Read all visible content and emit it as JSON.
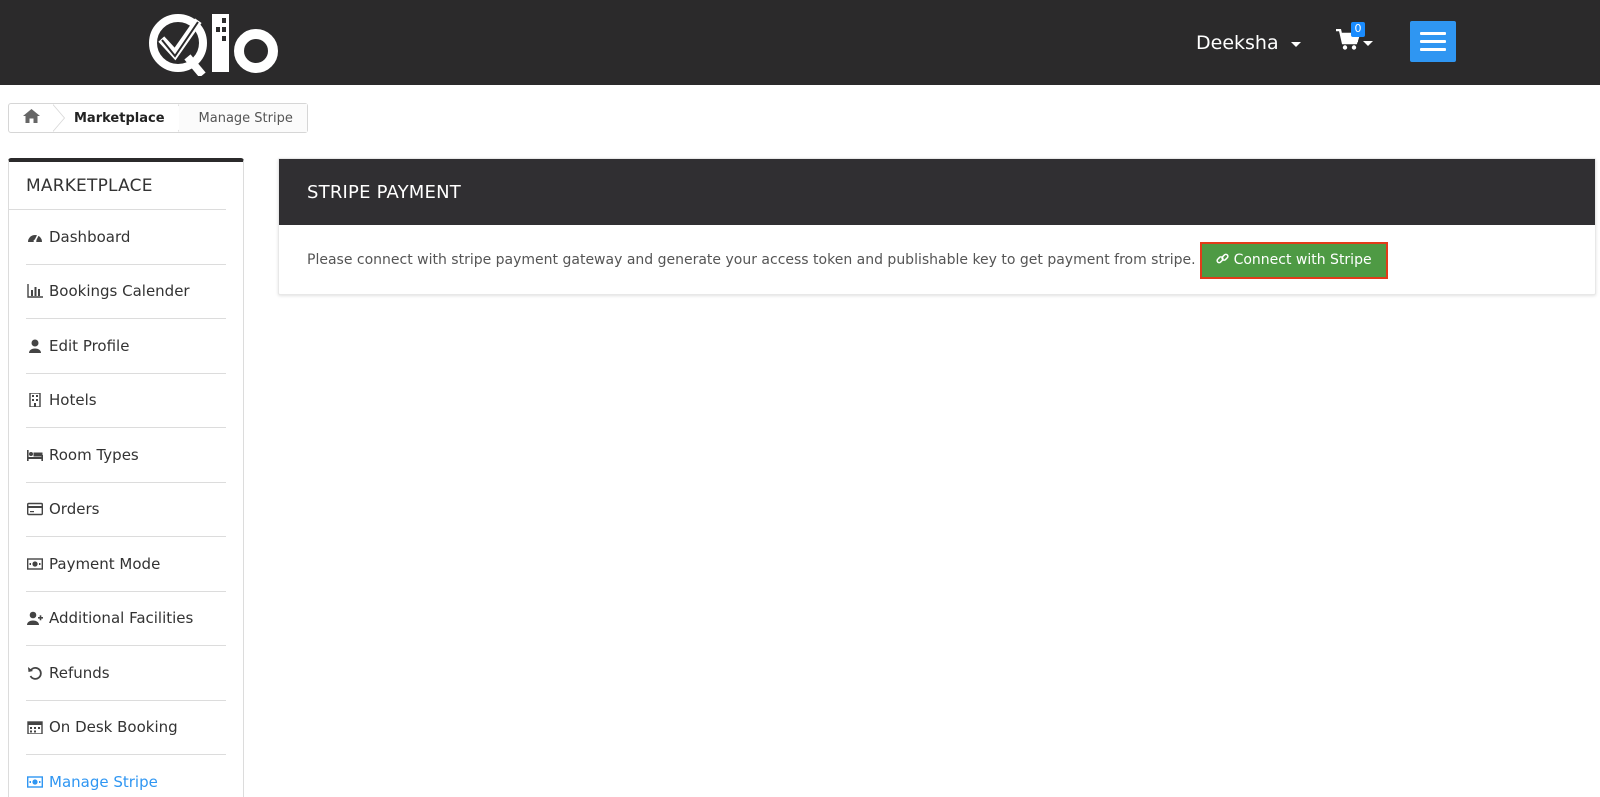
{
  "header": {
    "logo_text": "Qlo",
    "user_name": "Deeksha",
    "cart_count": "0",
    "menu_icon": "hamburger-icon"
  },
  "breadcrumb": {
    "home_icon": "home-icon",
    "items": [
      "Marketplace",
      "Manage Stripe"
    ]
  },
  "sidebar": {
    "title": "MARKETPLACE",
    "items": [
      {
        "label": "Dashboard",
        "icon": "dashboard-icon"
      },
      {
        "label": "Bookings Calender",
        "icon": "bar-chart-icon"
      },
      {
        "label": "Edit Profile",
        "icon": "user-icon"
      },
      {
        "label": "Hotels",
        "icon": "building-icon"
      },
      {
        "label": "Room Types",
        "icon": "bed-icon"
      },
      {
        "label": "Orders",
        "icon": "credit-card-icon"
      },
      {
        "label": "Payment Mode",
        "icon": "money-icon"
      },
      {
        "label": "Additional Facilities",
        "icon": "user-plus-icon"
      },
      {
        "label": "Refunds",
        "icon": "undo-icon"
      },
      {
        "label": "On Desk Booking",
        "icon": "calendar-icon"
      },
      {
        "label": "Manage Stripe",
        "icon": "money-icon"
      }
    ],
    "active_item": "Manage Stripe"
  },
  "panel": {
    "title": "STRIPE PAYMENT",
    "message": "Please connect with stripe payment gateway and generate your access token and publishable key to get payment from stripe.",
    "button_label": "Connect with Stripe",
    "button_icon": "link-icon"
  },
  "colors": {
    "header_bg": "#2b2a2b",
    "accent_blue": "#2f96f2",
    "button_green": "#4e9a44",
    "button_outline": "#e23b1a"
  }
}
